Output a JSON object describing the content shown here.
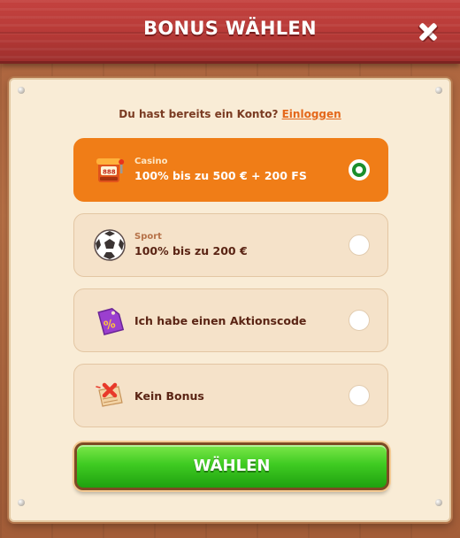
{
  "header": {
    "title": "BONUS WÄHLEN",
    "close_icon": "close-icon"
  },
  "login": {
    "prompt": "Du hast bereits ein Konto?",
    "link_label": "Einloggen"
  },
  "options": [
    {
      "id": "casino",
      "category": "Casino",
      "label": "100% bis zu 500 € + 200 FS",
      "icon": "slot-machine-icon",
      "selected": true
    },
    {
      "id": "sport",
      "category": "Sport",
      "label": "100% bis zu 200 €",
      "icon": "soccer-ball-icon",
      "selected": false
    },
    {
      "id": "promo",
      "category": "",
      "label": "Ich habe einen Aktionscode",
      "icon": "percent-tag-icon",
      "selected": false
    },
    {
      "id": "none",
      "category": "",
      "label": "Kein Bonus",
      "icon": "no-bonus-map-icon",
      "selected": false
    }
  ],
  "submit": {
    "label": "WÄHLEN"
  },
  "colors": {
    "header": "#b73a37",
    "panel": "#f9ecd6",
    "selected_option": "#f07d17",
    "option": "#f5e2c9",
    "button_green": "#3fcb22",
    "link": "#e4681b",
    "radio_checked": "#1c8f2c"
  }
}
